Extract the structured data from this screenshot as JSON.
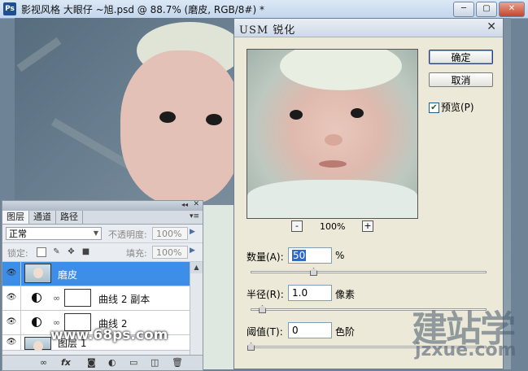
{
  "window": {
    "app_badge": "Ps",
    "title": "影视风格 大眼仔 ~旭.psd @ 88.7% (磨皮, RGB/8#) *",
    "minimize": "─",
    "maximize": "▢",
    "close": "✕"
  },
  "layers_panel": {
    "tabs": [
      "图层",
      "通道",
      "路径"
    ],
    "blend_mode": "正常",
    "opacity_label": "不透明度:",
    "opacity_value": "100%",
    "lock_label": "锁定:",
    "fill_label": "填充:",
    "fill_value": "100%",
    "layers": [
      {
        "name": "磨皮",
        "selected": true
      },
      {
        "name": "曲线 2 副本",
        "selected": false
      },
      {
        "name": "曲线 2",
        "selected": false
      },
      {
        "name": "图层 1",
        "selected": false
      }
    ],
    "bottom_icons": [
      "link-icon",
      "fx-icon",
      "mask-icon",
      "adjustment-icon",
      "group-icon",
      "new-layer-icon",
      "trash-icon"
    ]
  },
  "usm_dialog": {
    "title": "USM 锐化",
    "close": "✕",
    "ok_label": "确定",
    "cancel_label": "取消",
    "preview_label": "预览(P)",
    "preview_checked": true,
    "zoom_minus": "-",
    "zoom_plus": "+",
    "zoom_value": "100%",
    "amount": {
      "label": "数量(A):",
      "value": "50",
      "unit": "%"
    },
    "radius": {
      "label": "半径(R):",
      "value": "1.0",
      "unit": "像素"
    },
    "threshold": {
      "label": "阈值(T):",
      "value": "0",
      "unit": "色阶"
    }
  },
  "watermarks": {
    "site1": "www.68ps.com",
    "site2_cn": "建站学",
    "site2_url": "jzxue.com"
  }
}
